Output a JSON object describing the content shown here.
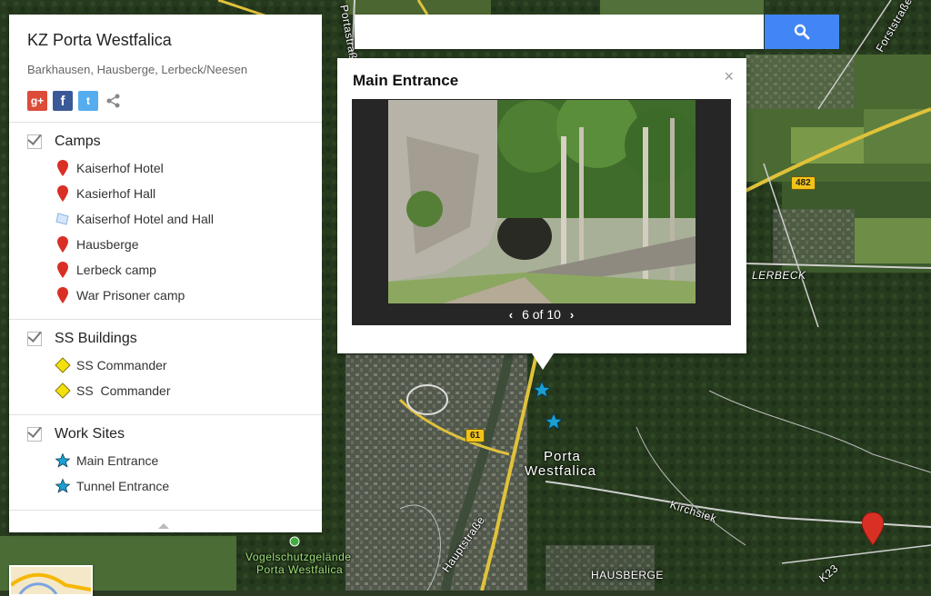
{
  "sidebar": {
    "title": "KZ Porta Westfalica",
    "subtitle": "Barkhausen, Hausberge, Lerbeck/Neesen",
    "share": {
      "gplus": "g+",
      "facebook": "f",
      "twitter": "t"
    },
    "layers": [
      {
        "name": "Camps",
        "checked": true,
        "features": [
          {
            "label": "Kaiserhof Hotel",
            "icon": "red-pin-icon"
          },
          {
            "label": "Kasierhof Hall",
            "icon": "red-pin-icon"
          },
          {
            "label": "Kaiserhof Hotel and Hall",
            "icon": "polygon-icon"
          },
          {
            "label": "Hausberge",
            "icon": "red-pin-icon"
          },
          {
            "label": "Lerbeck camp",
            "icon": "red-pin-icon"
          },
          {
            "label": "War Prisoner camp",
            "icon": "red-pin-icon"
          }
        ]
      },
      {
        "name": "SS Buildings",
        "checked": true,
        "features": [
          {
            "label": "SS Commander",
            "icon": "yellow-diamond-icon"
          },
          {
            "label": "SS  Commander",
            "icon": "yellow-diamond-icon"
          }
        ]
      },
      {
        "name": "Work Sites",
        "checked": true,
        "features": [
          {
            "label": "Main Entrance",
            "icon": "blue-star-icon"
          },
          {
            "label": "Tunnel Entrance",
            "icon": "blue-star-icon"
          }
        ]
      }
    ]
  },
  "search": {
    "value": "",
    "placeholder": ""
  },
  "info_window": {
    "title": "Main Entrance",
    "counter": "6 of 10",
    "prev": "‹",
    "next": "›",
    "close": "×"
  },
  "map_labels": {
    "porta": "Porta",
    "westfalica": "Westfalica",
    "lerbeck": "LERBECK",
    "hausberge": "HAUSBERGE",
    "kirchsiek": "Kirchsiek",
    "hauptstrasse": "Hauptstraße",
    "portastrasse": "Portastraße",
    "forststrasse": "Forststraße",
    "vogel1": "Vogelschutzgelände",
    "vogel2": "Porta Westfalica",
    "k23": "K23",
    "road_61": "61",
    "road_482": "482"
  },
  "colors": {
    "accent_blue": "#4285f4",
    "pin_red": "#d93025",
    "star_blue": "#1a9fd0",
    "diamond_yellow": "#f3e10e"
  }
}
